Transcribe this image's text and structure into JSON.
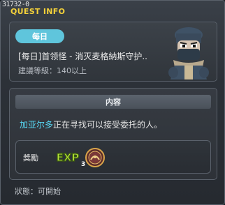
{
  "window": {
    "id_text": "31732-0",
    "title": "QUEST INFO"
  },
  "quest": {
    "badge": "每日",
    "name": "[每日]首领怪 - 消灭麦格納斯守护..",
    "level_req": "建議等級：140以上"
  },
  "content": {
    "section_title": "内容",
    "npc_name": "加亚尔多",
    "description": "正在寻找可以接受委托的人。"
  },
  "reward": {
    "label": "獎勵",
    "exp_icon": "EXP",
    "coin_count": "3"
  },
  "status": {
    "text": "狀態：可開始"
  },
  "colors": {
    "title": "#f5d23a",
    "badge": "#5fc5dc",
    "npc_name": "#57d6f2"
  },
  "icons": [
    "npc-portrait",
    "exp-icon",
    "coin-icon"
  ]
}
